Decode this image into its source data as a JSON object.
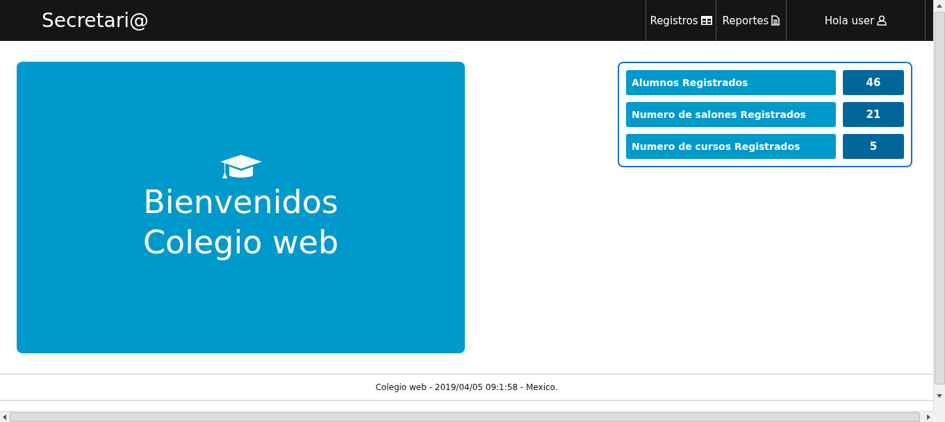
{
  "navbar": {
    "brand": "Secretari@",
    "items": [
      {
        "label": "Registros",
        "kind": "table"
      },
      {
        "label": "Reportes",
        "kind": "file"
      },
      {
        "label": "Hola user",
        "kind": "user"
      }
    ]
  },
  "welcome": {
    "lines": [
      "Bienvenidos",
      "Colegio web"
    ]
  },
  "stats": [
    {
      "label": "Alumnos Registrados",
      "value": "46"
    },
    {
      "label": "Numero de salones Registrados",
      "value": "21"
    },
    {
      "label": "Numero de cursos Registrados",
      "value": "5"
    }
  ],
  "footer": "Colegio web - 2019/04/05 09:1:58 - Mexico."
}
